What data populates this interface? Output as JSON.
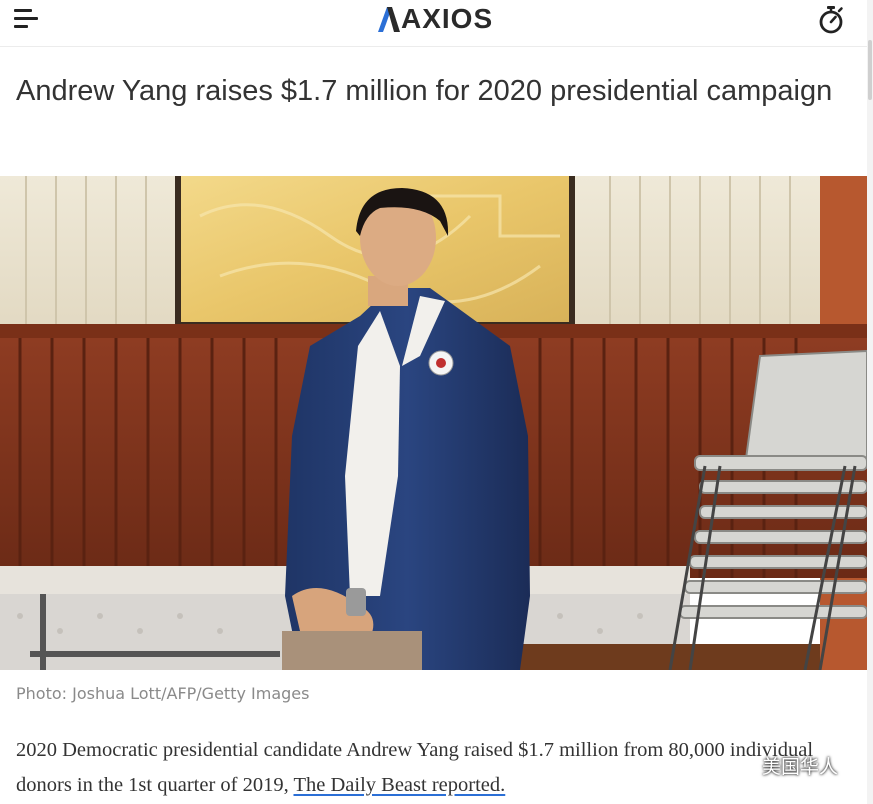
{
  "header": {
    "logo_text": "AXIOS",
    "menu_icon": "hamburger-menu-icon",
    "timer_icon": "stopwatch-icon"
  },
  "article": {
    "headline": "Andrew Yang raises $1.7 million for 2020 presidential campaign",
    "photo_caption": "Photo: Joshua Lott/AFP/Getty Images",
    "body_prefix": "2020 Democratic presidential candidate Andrew Yang raised $1.7 million from 80,000 individual donors in the 1st quarter of 2019, ",
    "body_link": "The Daily Beast reported."
  },
  "watermark": {
    "text": "美国华人",
    "icon": "wechat-icon"
  },
  "colors": {
    "logo_accent": "#2b6fd6",
    "text": "#333333",
    "caption": "#8a8a8a"
  }
}
